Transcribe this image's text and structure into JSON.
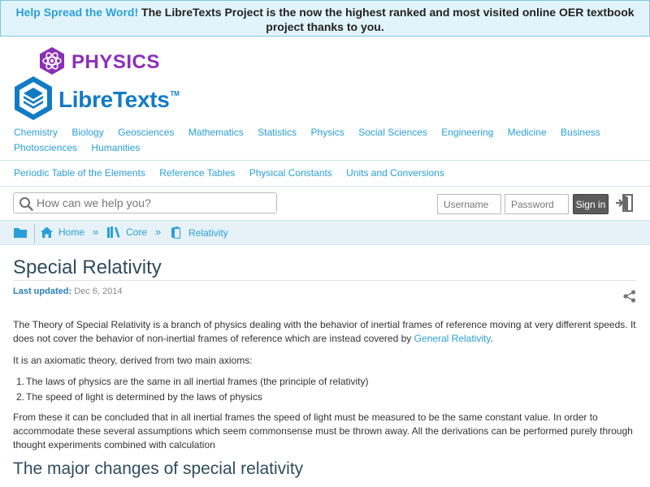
{
  "banner": {
    "highlight": "Help Spread the Word!",
    "text": " The LibreTexts Project is the now the highest ranked and most visited online OER textbook project thanks to you."
  },
  "logo": {
    "library": "PHYSICS",
    "brand": "LibreTexts",
    "trademark": "TM"
  },
  "subjects": [
    "Chemistry",
    "Biology",
    "Geosciences",
    "Mathematics",
    "Statistics",
    "Physics",
    "Social Sciences",
    "Engineering",
    "Medicine",
    "Business",
    "Photosciences",
    "Humanities"
  ],
  "references": [
    "Periodic Table of the Elements",
    "Reference Tables",
    "Physical Constants",
    "Units and Conversions"
  ],
  "search": {
    "placeholder": "How can we help you?"
  },
  "login": {
    "username_placeholder": "Username",
    "password_placeholder": "Password",
    "signin_label": "Sign in"
  },
  "breadcrumb": {
    "home": "Home",
    "core": "Core",
    "current": "Relativity",
    "separator": "»"
  },
  "article": {
    "title": "Special Relativity",
    "updated_label": "Last updated:",
    "updated_value": "Dec 6, 2014",
    "p1": "The Theory of Special Relativity is a branch of physics dealing with the behavior of inertial frames of reference moving at very different speeds. It does not cover the behavior of non-inertial frames of reference which are instead covered by ",
    "p1_link": "General Relativity",
    "p1_end": ".",
    "p2": "It is an axiomatic theory, derived from two main axioms:",
    "axioms": [
      {
        "num": "1.",
        "text": "The laws of physics are the same in all inertial frames (the principle of relativity)"
      },
      {
        "num": "2.",
        "text": "The speed of light is determined by the laws of physics"
      }
    ],
    "p3": "From these it can be concluded that in all inertial frames the speed of light must be measured to be the same constant value. In order to accommodate these several assumptions which seem commonsense must be thrown away. All the derivations can be performed purely through thought experiments combined with calculation",
    "h2": "The major changes of special relativity"
  },
  "colors": {
    "link": "#2a9fd6",
    "brand_blue": "#127bc4",
    "physics_purple": "#8a2fb9",
    "banner_bg": "#e2f4fb"
  }
}
